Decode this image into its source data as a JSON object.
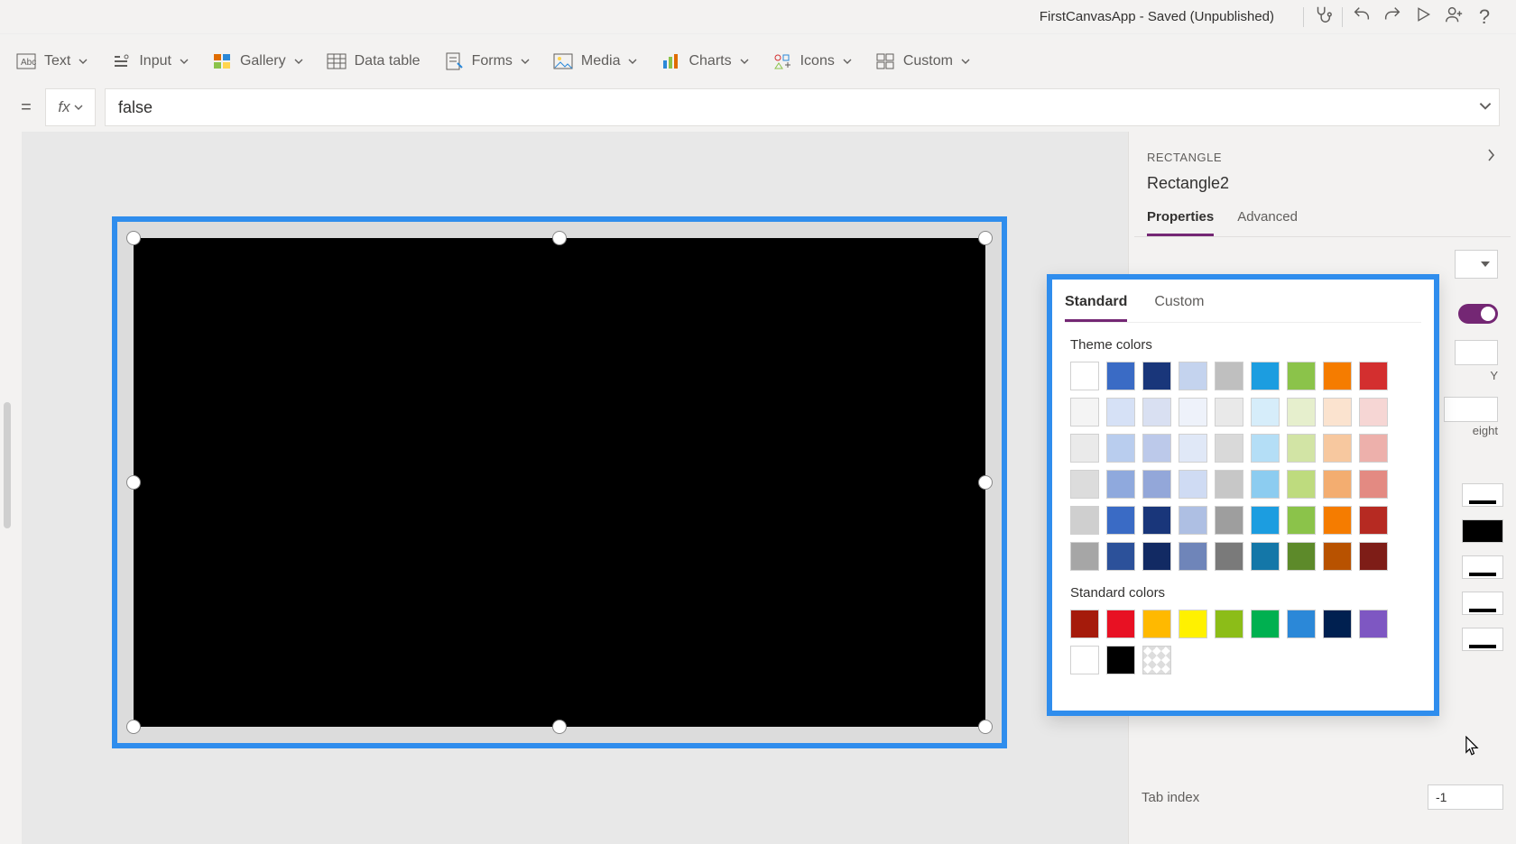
{
  "titleBar": {
    "appTitle": "FirstCanvasApp - Saved (Unpublished)",
    "icons": [
      "stethoscope-icon",
      "undo-icon",
      "redo-icon",
      "play-icon",
      "share-icon",
      "help-icon"
    ]
  },
  "ribbon": {
    "items": [
      {
        "label": "Text",
        "icon": "text-icon",
        "hasChevron": true
      },
      {
        "label": "Input",
        "icon": "input-icon",
        "hasChevron": true
      },
      {
        "label": "Gallery",
        "icon": "gallery-icon",
        "hasChevron": true
      },
      {
        "label": "Data table",
        "icon": "datatable-icon",
        "hasChevron": false
      },
      {
        "label": "Forms",
        "icon": "forms-icon",
        "hasChevron": true
      },
      {
        "label": "Media",
        "icon": "media-icon",
        "hasChevron": true
      },
      {
        "label": "Charts",
        "icon": "charts-icon",
        "hasChevron": true
      },
      {
        "label": "Icons",
        "icon": "icons-icon",
        "hasChevron": true
      },
      {
        "label": "Custom",
        "icon": "custom-icon",
        "hasChevron": true
      }
    ]
  },
  "formula": {
    "equals": "=",
    "fx": "fx",
    "value": "false"
  },
  "propsPanel": {
    "typeLabel": "RECTANGLE",
    "controlName": "Rectangle2",
    "tabs": {
      "properties": "Properties",
      "advanced": "Advanced"
    },
    "rows": {
      "toggleOn": true,
      "axisY": "Y",
      "heightLabel": "eight",
      "tabIndexLabel": "Tab index",
      "tabIndexValue": "-1"
    }
  },
  "colorPicker": {
    "tabs": {
      "standard": "Standard",
      "custom": "Custom"
    },
    "themeTitle": "Theme colors",
    "themeColors": [
      "#ffffff",
      "#3a6bc5",
      "#19367a",
      "#c4d3ee",
      "#bfbfbf",
      "#1c9de0",
      "#8bc34a",
      "#f57c00",
      "#d32f2f",
      "#f4f4f4",
      "#d6e1f6",
      "#d9e0f2",
      "#eef2fa",
      "#e9e9e9",
      "#d6edfa",
      "#e6efcd",
      "#fbe3cf",
      "#f6d6d4",
      "#eaeaea",
      "#b9cdee",
      "#bcc9ea",
      "#e0e8f7",
      "#d9d9d9",
      "#b4def6",
      "#d2e4a5",
      "#f7c89f",
      "#edb0ab",
      "#dcdcdc",
      "#8fa9dd",
      "#93a7d9",
      "#cfdbf3",
      "#c7c7c7",
      "#8cccf0",
      "#bedb7e",
      "#f3ad70",
      "#e38a82",
      "#cfcfcf",
      "#3a6bc5",
      "#19367a",
      "#aebfe3",
      "#9e9e9e",
      "#1c9de0",
      "#8bc34a",
      "#f57c00",
      "#b62a22",
      "#a6a6a6",
      "#2c519a",
      "#122a63",
      "#6f85b9",
      "#7a7a7a",
      "#1477a8",
      "#5d8a2a",
      "#b85200",
      "#7e1d17"
    ],
    "standardTitle": "Standard colors",
    "standardColors": [
      "#a51b0b",
      "#e81123",
      "#ffb900",
      "#fff100",
      "#8cbd18",
      "#00b050",
      "#2b88d8",
      "#002050",
      "#7e57c2"
    ],
    "extraRow": {
      "white": "#ffffff",
      "black": "#000000"
    }
  }
}
